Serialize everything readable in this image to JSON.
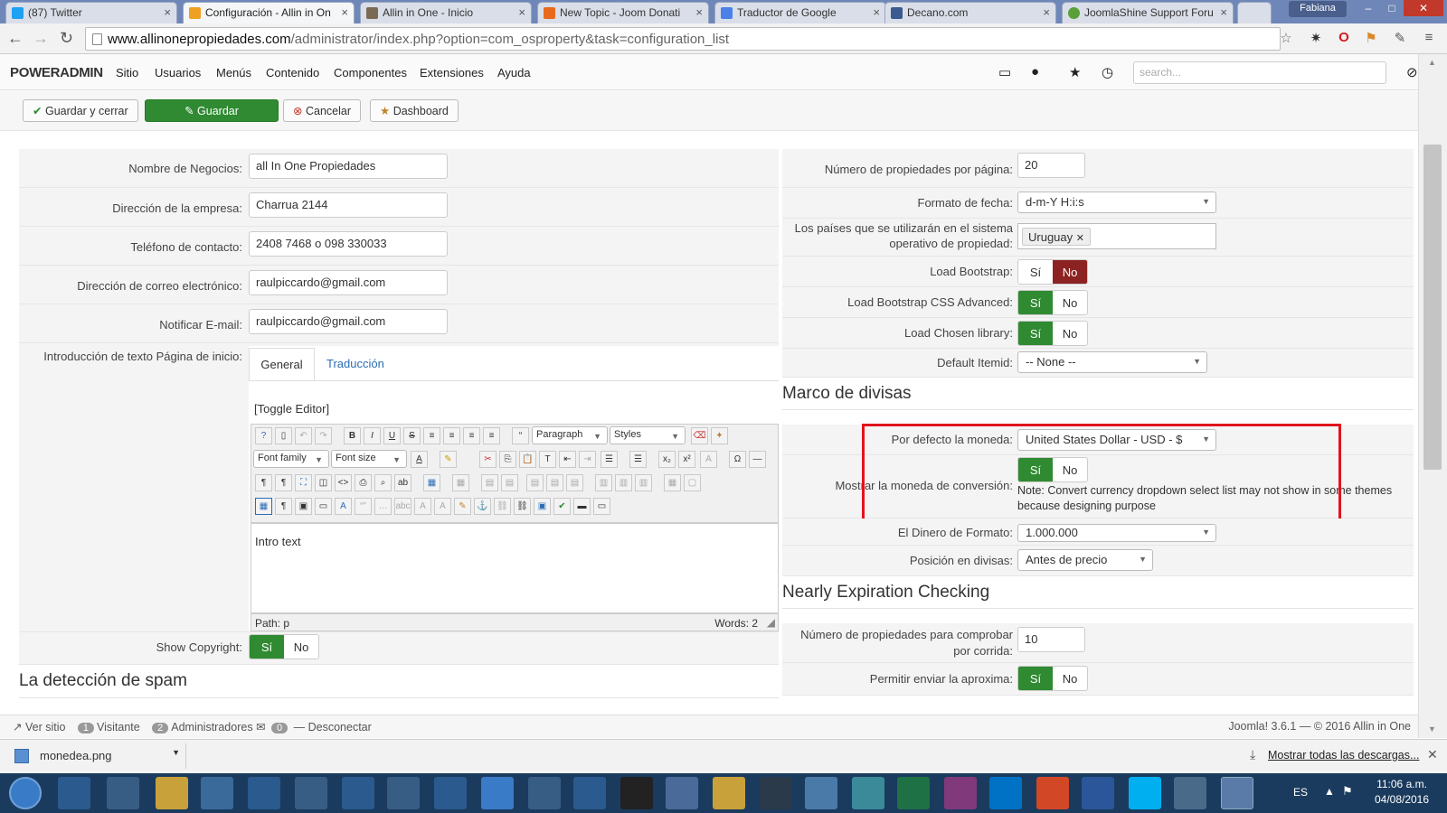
{
  "browser": {
    "tabs": [
      {
        "label": "(87) Twitter",
        "color": "#1da1f2"
      },
      {
        "label": "Configuración - Allin in On",
        "color": "#f0a020"
      },
      {
        "label": "Allin in One - Inicio",
        "color": "#7a6a55"
      },
      {
        "label": "New Topic - Joom Donati",
        "color": "#e86a1c"
      },
      {
        "label": "Traductor de Google",
        "color": "#4a80e8"
      },
      {
        "label": "Decano.com",
        "color": "#3a5a90"
      },
      {
        "label": "JoomlaShine Support Foru",
        "color": "#5aa038"
      }
    ],
    "user": "Fabiana",
    "url_host": "www.allinonepropiedades.com",
    "url_path": "/administrator/index.php?option=com_osproperty&task=configuration_list"
  },
  "admin": {
    "brand": "POWERADMIN",
    "menu": [
      "Sitio",
      "Usuarios",
      "Menús",
      "Contenido",
      "Componentes",
      "Extensiones",
      "Ayuda"
    ],
    "search_placeholder": "search..."
  },
  "toolbar": {
    "save_close": "Guardar y cerrar",
    "save": "Guardar",
    "cancel": "Cancelar",
    "dashboard": "Dashboard"
  },
  "left": {
    "business_name_label": "Nombre de Negocios:",
    "business_name": "all In One Propiedades",
    "address_label": "Dirección de la empresa:",
    "address": "Charrua 2144",
    "phone_label": "Teléfono de contacto:",
    "phone": "2408 7468 o 098 330033",
    "email_label": "Dirección de correo electrónico:",
    "email": "raulpiccardo@gmail.com",
    "notify_label": "Notificar E-mail:",
    "notify": "raulpiccardo@gmail.com",
    "intro_label": "Introducción de texto Página de inicio:",
    "tab_general": "General",
    "tab_translation": "Traducción",
    "toggle_editor": "[Toggle Editor]",
    "paragraph": "Paragraph",
    "styles": "Styles",
    "font_family": "Font family",
    "font_size": "Font size",
    "editor_text": "Intro text",
    "path": "Path:  p",
    "words": "Words: 2",
    "copyright_label": "Show Copyright:",
    "spam_heading": "La detección de spam"
  },
  "right": {
    "per_page_label": "Número de propiedades por página:",
    "per_page": "20",
    "date_format_label": "Formato de fecha:",
    "date_format": "d-m-Y H:i:s",
    "countries_label": "Los países que se utilizarán en el sistema operativo de propiedad:",
    "country": "Uruguay",
    "load_bootstrap_label": "Load Bootstrap:",
    "load_bootstrap_css_label": "Load Bootstrap CSS Advanced:",
    "load_chosen_label": "Load Chosen library:",
    "default_itemid_label": "Default Itemid:",
    "default_itemid": "-- None --",
    "currency_heading": "Marco de divisas",
    "default_currency_label": "Por defecto la moneda:",
    "default_currency": "United States Dollar - USD - $",
    "show_conversion_label": "Mostrar la moneda de conversión:",
    "conversion_note": "Note: Convert currency dropdown select list may not show in some themes because designing purpose",
    "money_format_label": "El Dinero de Formato:",
    "money_format": "1.000.000",
    "currency_position_label": "Posición en divisas:",
    "currency_position": "Antes de precio",
    "expiration_heading": "Nearly Expiration Checking",
    "props_check_label": "Número de propiedades para comprobar por corrida:",
    "props_check": "10",
    "allow_send_label": "Permitir enviar la aproxima:"
  },
  "toggle": {
    "yes": "Sí",
    "no": "No"
  },
  "status": {
    "view_site": "Ver sitio",
    "visitors_count": "1",
    "visitors": "Visitante",
    "admins_count": "2",
    "admins": "Administradores",
    "msgs_count": "0",
    "logout": "Desconectar",
    "version": "Joomla! 3.6.1  —  © 2016 Allin in One"
  },
  "downloads": {
    "file": "monedea.png",
    "show_all": "Mostrar todas las descargas..."
  },
  "taskbar": {
    "lang": "ES",
    "time": "11:06 a.m.",
    "date": "04/08/2016"
  },
  "colors": {
    "green": "#2f8a31",
    "red": "#8c2221",
    "highlight": "#e0141e"
  }
}
